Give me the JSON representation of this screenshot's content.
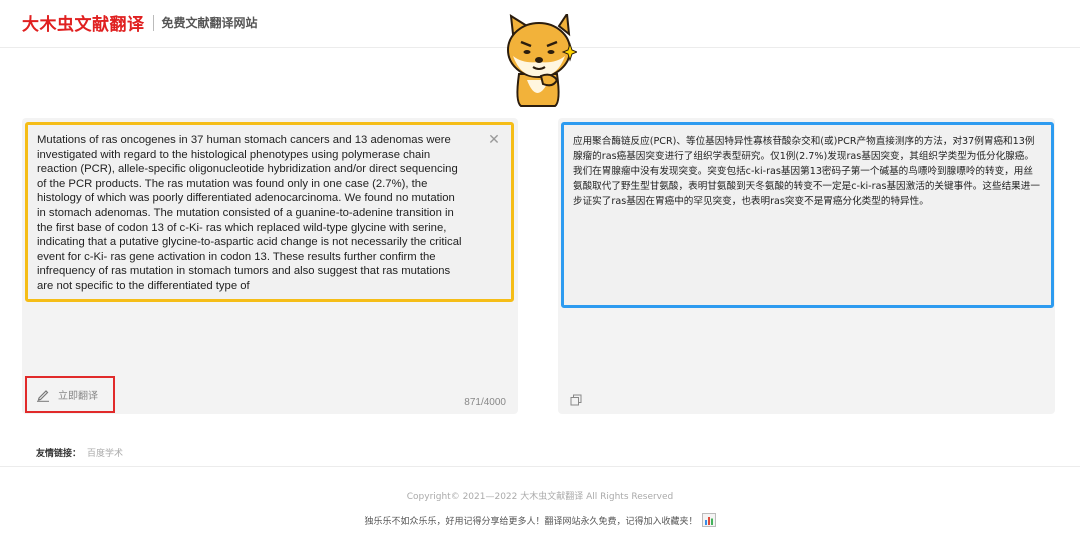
{
  "header": {
    "brand": "大木虫文献翻译",
    "subtitle": "免费文献翻译网站"
  },
  "source": {
    "text": "Mutations of ras oncogenes in 37 human stomach cancers and 13 adenomas were\ninvestigated with regard to the histological phenotypes using polymerase chain\nreaction (PCR), allele-specific oligonucleotide hybridization and/or direct sequencing\nof the PCR products. The ras mutation was found only in one case (2.7%), the\nhistology of which was poorly differentiated adenocarcinoma. We found no mutation\nin stomach adenomas. The mutation consisted of a guanine-to-adenine transition in\nthe first base of codon 13 of c-Ki- ras which replaced wild-type glycine with serine,\nindicating that a putative glycine-to-aspartic acid change is not necessarily the critical\nevent for c-Ki- ras gene activation in codon 13. These results further confirm the\ninfrequency of ras mutation in stomach tumors and also suggest that ras mutations\nare not specific to the differentiated type of",
    "translate_label": "立即翻译",
    "counter": "871/4000",
    "accent_color": "#f5bd17"
  },
  "target": {
    "text": "应用聚合酶链反应(PCR)、等位基因特异性寡核苷酸杂交和(或)PCR产物直接测序的方法，对37例胃癌和13例腺瘤的ras癌基因突变进行了组织学表型研究。仅1例(2.7%)发现ras基因突变，其组织学类型为低分化腺癌。我们在胃腺瘤中没有发现突变。突变包括c-ki-ras基因第13密码子第一个碱基的鸟嘌呤到腺嘌呤的转变，用丝氨酸取代了野生型甘氨酸，表明甘氨酸到天冬氨酸的转变不一定是c-ki-ras基因激活的关键事件。这些结果进一步证实了ras基因在胃癌中的罕见突变，也表明ras突变不是胃癌分化类型的特异性。",
    "accent_color": "#2d9bf0"
  },
  "links": {
    "label": "友情链接：",
    "items": [
      "百度学术"
    ]
  },
  "footer": {
    "copyright": "Copyright© 2021—2022 大木虫文献翻译 All Rights Reserved",
    "slogan": "独乐乐不如众乐乐，好用记得分享给更多人！翻译网站永久免费，记得加入收藏夹！"
  },
  "icons": {
    "clear": "close-icon",
    "translate": "pencil-icon",
    "copy": "copy-icon",
    "mascot": "shiba-dog-mascot",
    "footer": "chart-icon"
  },
  "colors": {
    "brand": "#e02020",
    "highlight_button_border": "#e12a2a"
  }
}
